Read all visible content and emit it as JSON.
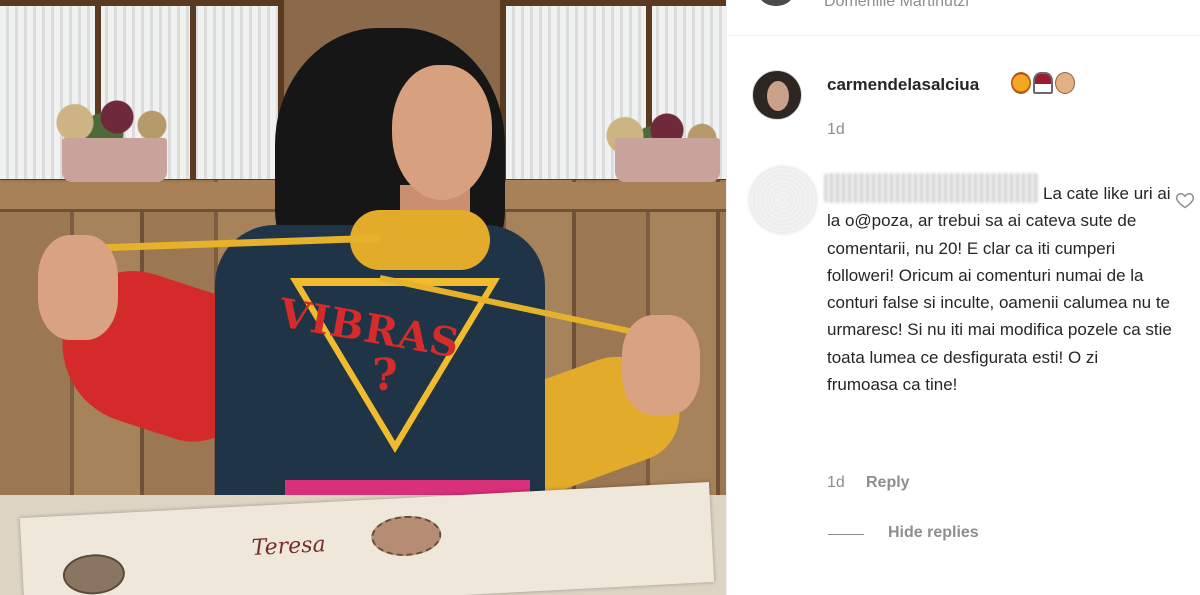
{
  "post": {
    "above_comment_text": "Domeniile Martinutzi"
  },
  "photo": {
    "hoodie_logo_text": "VIBRAS",
    "hoodie_logo_symbol": "?",
    "menu_title": "Teresa"
  },
  "caption": {
    "username": "carmendelasalciua",
    "emojis": [
      "fire-emoji",
      "wine-glass-emoji",
      "ok-hand-emoji"
    ],
    "time": "1d"
  },
  "reply_comment": {
    "username_redacted": true,
    "text": "La cate like uri ai la o@poza, ar trebui sa ai cateva sute de comentarii, nu 20! E clar ca iti cumperi followeri! Oricum ai comenturi numai de la conturi false si inculte, oamenii calumea nu te urmaresc! Si nu iti mai modifica pozele ca stie toata lumea ce desfigurata esti! O zi frumoasa ca tine!",
    "time": "1d",
    "reply_label": "Reply",
    "like_icon": "heart-outline-icon"
  },
  "thread": {
    "hide_replies_label": "Hide replies"
  },
  "colors": {
    "text_primary": "#262626",
    "text_secondary": "#8e8e8e",
    "divider": "#efefef"
  }
}
